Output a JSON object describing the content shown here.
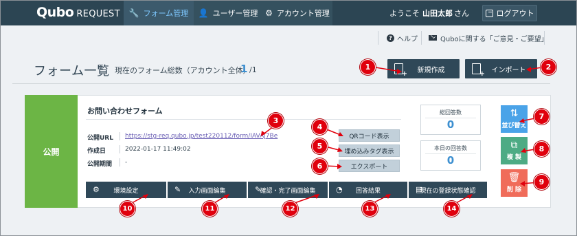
{
  "header": {
    "logo_brand": "Qubo",
    "logo_sub": "REQUEST",
    "tabs": [
      {
        "label": "フォーム管理",
        "icon": "wrench-icon"
      },
      {
        "label": "ユーザー管理",
        "icon": "user-icon"
      },
      {
        "label": "アカウント管理",
        "icon": "gear-icon"
      }
    ],
    "welcome_prefix": "ようこそ",
    "user_name": "山田太郎",
    "welcome_suffix": "さん",
    "logout_label": "ログアウト"
  },
  "sublinks": {
    "help": "ヘルプ",
    "feedback": "Quboに関する「ご意見・ご要望」"
  },
  "page": {
    "title": "フォーム一覧",
    "count_label": "現在のフォーム総数（アカウント全体）",
    "count_value": "1",
    "count_total": "/1",
    "new_button": "新規作成",
    "import_button": "インポート"
  },
  "form": {
    "status": "公開",
    "name": "お問い合わせフォーム",
    "url_label": "公開URL",
    "url": "https://stg-req.qubo.jp/test220112/form/IAVAj7Be",
    "created_label": "作成日",
    "created": "2022-01-17 11:49:02",
    "period_label": "公開期間",
    "period": "-",
    "qr_button": "QRコード表示",
    "embed_button": "埋め込みタグ表示",
    "export_button": "エクスポート",
    "total_label": "総回答数",
    "total_value": "0",
    "today_label": "本日の回答数",
    "today_value": "0",
    "sort_button": "並び替え",
    "copy_button": "複 製",
    "delete_button": "削 除",
    "bottom_buttons": [
      {
        "label": "環境設定",
        "icon": "gear-icon"
      },
      {
        "label": "入力画面編集",
        "icon": "edit-form-icon"
      },
      {
        "label": "確認・完了画面編集",
        "icon": "edit-form-icon"
      },
      {
        "label": "回答結果",
        "icon": "pie-chart-icon"
      },
      {
        "label": "現在の登録状態確認",
        "icon": "search-list-icon"
      }
    ]
  },
  "callouts": [
    "1",
    "2",
    "3",
    "4",
    "5",
    "6",
    "7",
    "8",
    "9",
    "10",
    "11",
    "12",
    "13",
    "14"
  ],
  "colors": {
    "header_bg": "#2c4553",
    "accent_blue": "#3c8fd0",
    "status_green": "#6cb545",
    "sort_blue": "#4aa3e8",
    "copy_green": "#4dab84",
    "delete_red": "#f06c5a",
    "callout_red": "#e0000d"
  }
}
